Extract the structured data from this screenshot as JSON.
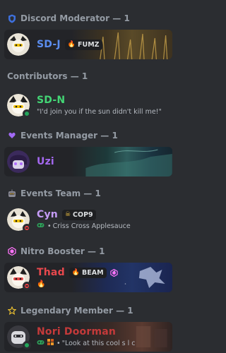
{
  "groups": [
    {
      "title": "Discord Moderator — 1",
      "icon": "shield-icon",
      "members": [
        {
          "name": "SD-J",
          "name_color": "#5b8def",
          "tag": "FUMZ",
          "tag_icon": "flame-purple-icon"
        }
      ]
    },
    {
      "title": "Contributors — 1",
      "icon": "",
      "members": [
        {
          "name": "SD-N",
          "name_color": "#43d675",
          "status": "online",
          "activity": "\"I'd join you if the sun didn't kill me!\""
        }
      ]
    },
    {
      "title": "Events Manager — 1",
      "icon": "heart-icon",
      "members": [
        {
          "name": "Uzi",
          "name_color": "#a468f0"
        }
      ]
    },
    {
      "title": "Events Team — 1",
      "icon": "robot-icon",
      "members": [
        {
          "name": "Cyn",
          "name_color": "#c59cf7",
          "status": "dnd",
          "tag": "COP9",
          "tag_icon": "skull-icon",
          "activity": "Criss Cross Applesauce",
          "activity_icon": "gamepad-icon"
        }
      ]
    },
    {
      "title": "Nitro Booster — 1",
      "icon": "boost-gem-icon",
      "members": [
        {
          "name": "Thad",
          "name_color": "#e8484d",
          "status": "dnd",
          "tag": "BEAM",
          "tag_icon": "fire-icon",
          "activity_icon": "fire-icon"
        }
      ]
    },
    {
      "title": "Legendary Member — 1",
      "icon": "star-icon",
      "members": [
        {
          "name": "Nori Doorman",
          "name_color": "#c43a3a",
          "status": "online",
          "activity": "\"Look at this cool s l c",
          "activity_icon": "gamepad-icon"
        }
      ]
    }
  ],
  "colors": {
    "background": "#2b2d31",
    "header_text": "#949ba4",
    "tag_bg": "#1e1f22"
  }
}
